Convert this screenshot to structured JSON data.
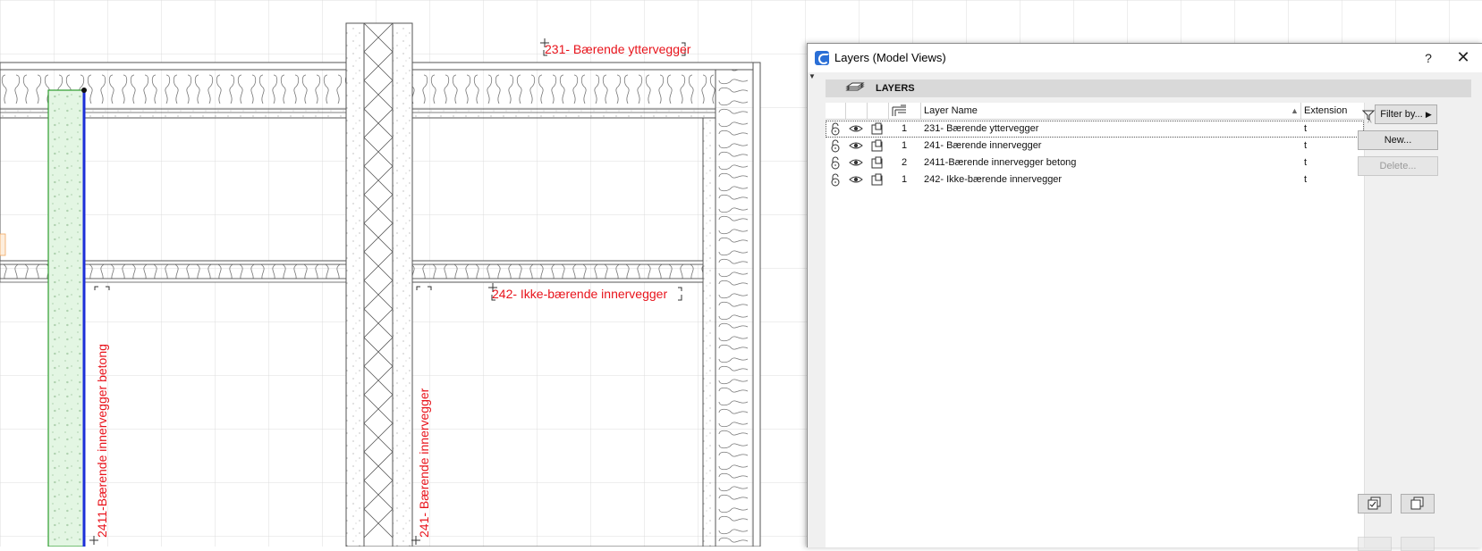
{
  "canvas": {
    "labels": {
      "outer_wall": "231- Bærende yttervegger",
      "non_bearing": "242- Ikke-bærende innervegger",
      "concrete_wall": "2411-Bærende innervegger betong",
      "inner_wall": "241- Bærende innervegger"
    },
    "label_color": "#e8131b"
  },
  "dialog": {
    "title": "Layers (Model Views)",
    "help": "?",
    "close": "✕",
    "section_header": "LAYERS",
    "columns": {
      "layer_name": "Layer Name",
      "extension": "Extension"
    },
    "rows": [
      {
        "count": "1",
        "name": "231- Bærende yttervegger",
        "extension": "t"
      },
      {
        "count": "1",
        "name": "241- Bærende innervegger",
        "extension": "t"
      },
      {
        "count": "2",
        "name": "2411-Bærende innervegger betong",
        "extension": "t"
      },
      {
        "count": "1",
        "name": "242- Ikke-bærende innervegger",
        "extension": "t"
      }
    ],
    "buttons": {
      "filter": "Filter by...",
      "new": "New...",
      "delete": "Delete..."
    }
  }
}
